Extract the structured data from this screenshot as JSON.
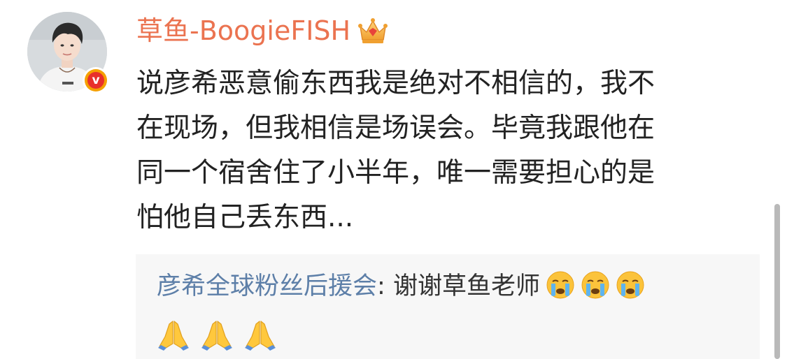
{
  "post": {
    "username": "草鱼-BoogieFISH",
    "content": "说彦希恶意偷东西我是绝对不相信的，我不在现场，但我相信是场误会。毕竟我跟他在同一个宿舍住了小半年，唯一需要担心的是怕他自己丢东西...",
    "content_lines": [
      "说彦希恶意偷东西我是绝对不相信的，我不",
      "在现场，但我相信是场误会。毕竟我跟他在",
      "同一个宿舍住了小半年，唯一需要担心的是",
      "怕他自己丢东西..."
    ],
    "badge_icon": "crown-icon",
    "verified_icon": "verified-v-icon",
    "username_color": "#eb7350"
  },
  "repost": {
    "author": "彦希全球粉丝后援会",
    "separator": ": ",
    "text": "谢谢草鱼老师",
    "emojis": [
      "crying-face-icon",
      "crying-face-icon",
      "crying-face-icon"
    ],
    "pray_emojis": [
      "folded-hands-icon",
      "folded-hands-icon",
      "folded-hands-icon"
    ],
    "author_color": "#5d7fa8"
  }
}
